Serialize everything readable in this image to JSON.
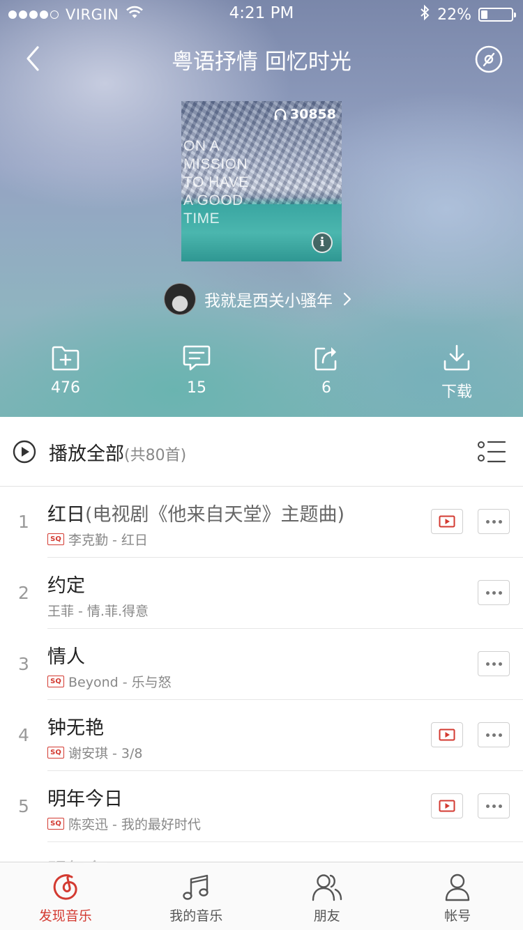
{
  "status_bar": {
    "carrier": "VIRGIN",
    "time": "4:21 PM",
    "battery": "22%",
    "battery_level": 0.22
  },
  "nav": {
    "title": "粤语抒情 回忆时光",
    "back_icon": "chevron-left-icon",
    "disc_icon": "disc-icon"
  },
  "playlist": {
    "play_count": "30858",
    "cover_text": "ON A\nMISSION\nTO HAVE\nA GOOD\nTIME",
    "creator": "我就是西关小骚年"
  },
  "actions": [
    {
      "icon": "folder-add-icon",
      "label": "476"
    },
    {
      "icon": "comment-icon",
      "label": "15"
    },
    {
      "icon": "share-icon",
      "label": "6"
    },
    {
      "icon": "download-icon",
      "label": "下载"
    }
  ],
  "play_all": {
    "label": "播放全部",
    "count": "(共80首)"
  },
  "songs": [
    {
      "index": "1",
      "title": "红日",
      "title_extra": "(电视剧《他来自天堂》主题曲)",
      "sq": true,
      "subtitle": "李克勤 - 红日",
      "mv": true
    },
    {
      "index": "2",
      "title": "约定",
      "title_extra": "",
      "sq": false,
      "subtitle": "王菲 - 情.菲.得意",
      "mv": false
    },
    {
      "index": "3",
      "title": "情人",
      "title_extra": "",
      "sq": true,
      "subtitle": "Beyond - 乐与怒",
      "mv": false
    },
    {
      "index": "4",
      "title": "钟无艳",
      "title_extra": "",
      "sq": true,
      "subtitle": "谢安琪 - 3/8",
      "mv": true
    },
    {
      "index": "5",
      "title": "明年今日",
      "title_extra": "",
      "sq": true,
      "subtitle": "陈奕迅 - 我的最好时代",
      "mv": true
    }
  ],
  "sq_label": "SQ",
  "tabs": [
    {
      "label": "发现音乐",
      "icon": "netease-music-icon",
      "active": true
    },
    {
      "label": "我的音乐",
      "icon": "music-note-icon",
      "active": false
    },
    {
      "label": "朋友",
      "icon": "friends-icon",
      "active": false
    },
    {
      "label": "帐号",
      "icon": "account-icon",
      "active": false
    }
  ],
  "colors": {
    "accent": "#d33a31",
    "header_top": "#7a87aa",
    "header_bottom": "#7bb4b6"
  }
}
